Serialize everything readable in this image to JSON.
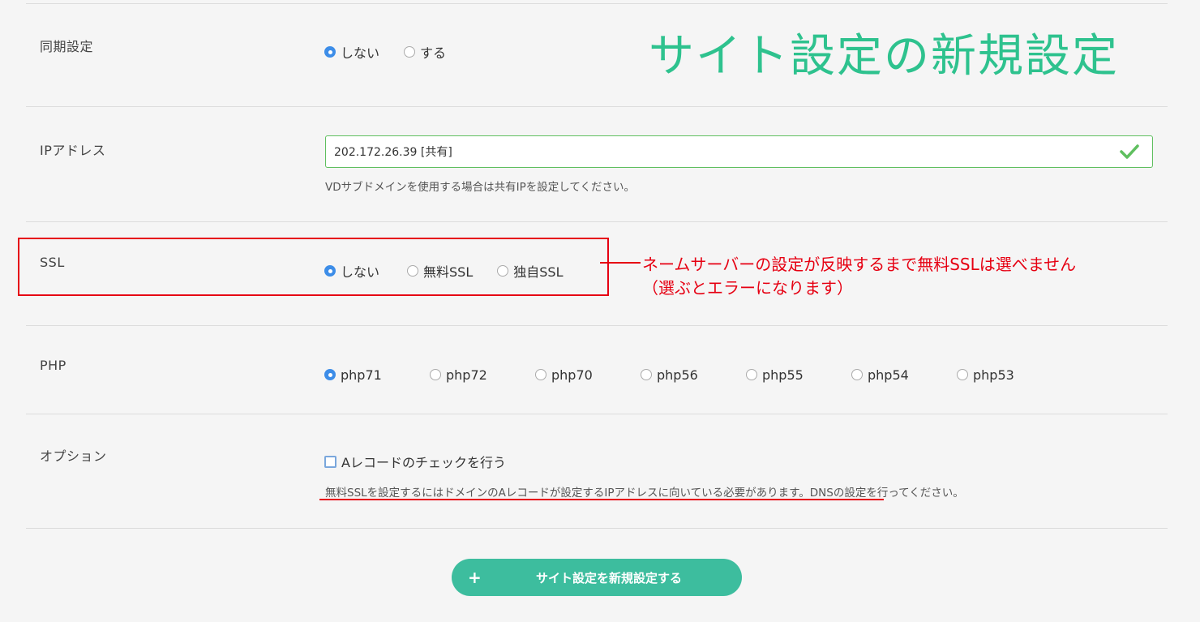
{
  "title_overlay": "サイト設定の新規設定",
  "sync": {
    "label": "同期設定",
    "options": [
      "しない",
      "する"
    ],
    "selected": "しない"
  },
  "ip": {
    "label": "IPアドレス",
    "value": "202.172.26.39 [共有]",
    "help": "VDサブドメインを使用する場合は共有IPを設定してください。",
    "valid_color": "#5fbf5f"
  },
  "ssl": {
    "label": "SSL",
    "options": [
      "しない",
      "無料SSL",
      "独自SSL"
    ],
    "selected": "しない"
  },
  "annotation": {
    "line1": "ネームサーバーの設定が反映するまで無料SSLは選べません",
    "line2": "（選ぶとエラーになります）",
    "color": "#e60012"
  },
  "php": {
    "label": "PHP",
    "options": [
      "php71",
      "php72",
      "php70",
      "php56",
      "php55",
      "php54",
      "php53"
    ],
    "selected": "php71"
  },
  "option": {
    "label": "オプション",
    "checkbox_label": "Aレコードのチェックを行う",
    "checked": false,
    "help": "無料SSLを設定するにはドメインのAレコードが設定するIPアドレスに向いている必要があります。DNSの設定を行ってください。"
  },
  "submit": {
    "icon": "plus-icon",
    "label": "サイト設定を新規設定する",
    "color": "#3dbd9e"
  },
  "colors": {
    "accent_title": "#2ec28e",
    "radio_checked": "#3d8de8"
  }
}
